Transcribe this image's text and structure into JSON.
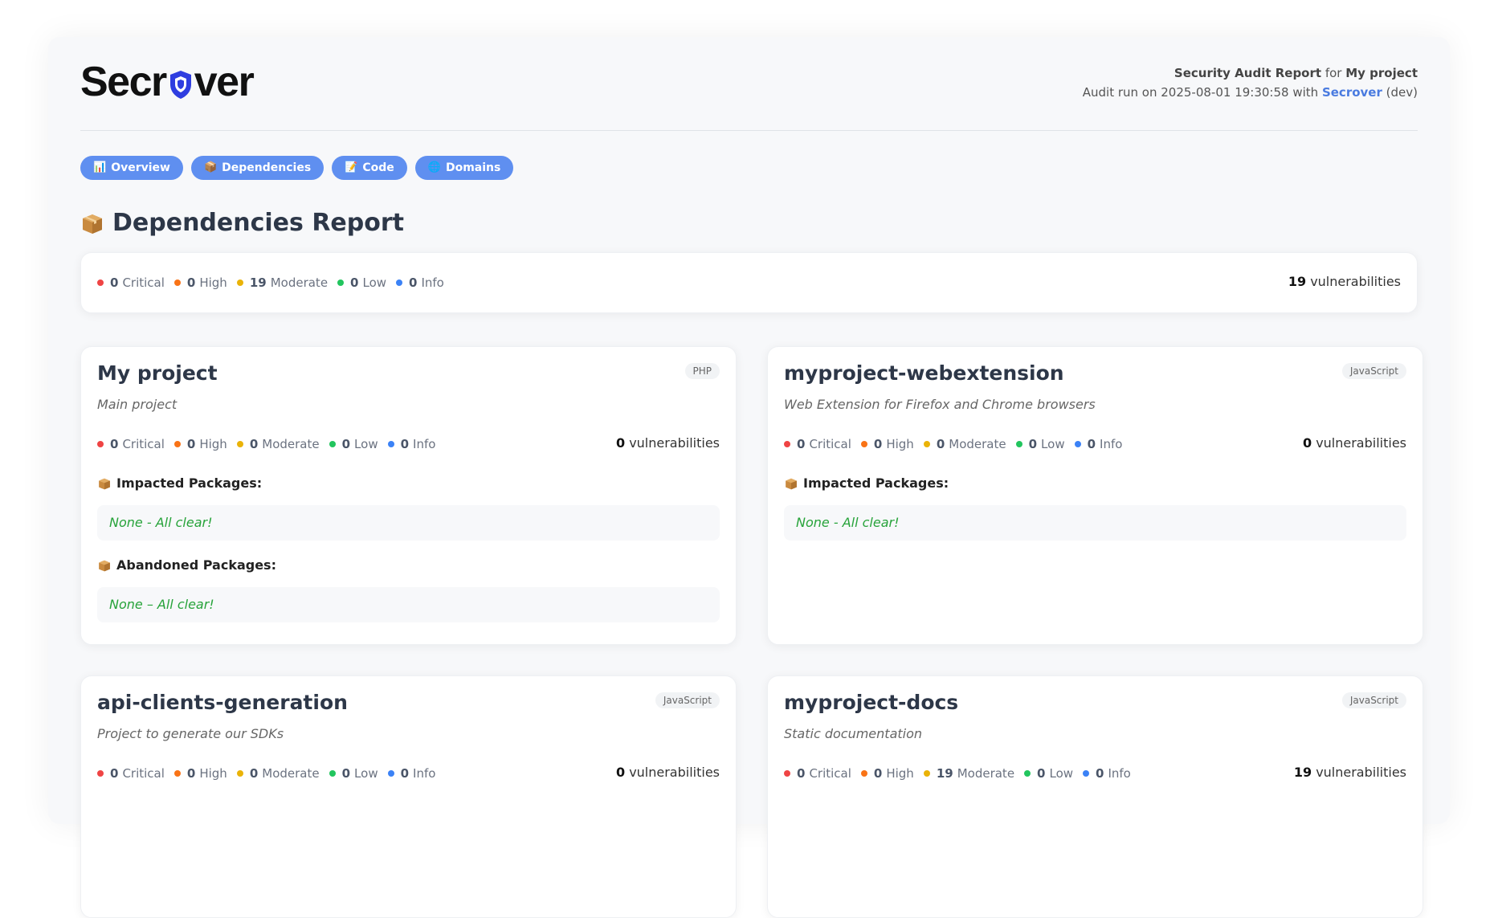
{
  "brand": {
    "logo_text_pre": "Secr",
    "logo_text_post": "ver"
  },
  "header": {
    "report_label": "Security Audit Report",
    "for_label": "for",
    "project_name": "My project",
    "audit_prefix": "Audit run on 2025-08-01 19:30:58 with",
    "tool_name": "Secrover",
    "tool_suffix": "(dev)"
  },
  "tabs": [
    {
      "icon": "📊",
      "label": "Overview"
    },
    {
      "icon": "📦",
      "label": "Dependencies"
    },
    {
      "icon": "📝",
      "label": "Code"
    },
    {
      "icon": "🌐",
      "label": "Domains"
    }
  ],
  "page_title": "Dependencies Report",
  "severity_labels": {
    "critical": "Critical",
    "high": "High",
    "moderate": "Moderate",
    "low": "Low",
    "info": "Info"
  },
  "colors": {
    "critical": "#ef4444",
    "high": "#f97316",
    "moderate": "#eab308",
    "low": "#22c55e",
    "info": "#3b82f6",
    "accent": "#5f8ff0",
    "clear": "#27a33a"
  },
  "summary": {
    "critical": "0",
    "high": "0",
    "moderate": "19",
    "low": "0",
    "info": "0",
    "total": "19",
    "total_label": "vulnerabilities"
  },
  "projects": [
    {
      "name": "My project",
      "language": "PHP",
      "description": "Main project",
      "critical": "0",
      "high": "0",
      "moderate": "0",
      "low": "0",
      "info": "0",
      "total": "0",
      "impacted_title": "Impacted Packages:",
      "impacted_status": "None - All clear!",
      "abandoned_title": "Abandoned Packages:",
      "abandoned_status": "None – All clear!"
    },
    {
      "name": "myproject-webextension",
      "language": "JavaScript",
      "description": "Web Extension for Firefox and Chrome browsers",
      "critical": "0",
      "high": "0",
      "moderate": "0",
      "low": "0",
      "info": "0",
      "total": "0",
      "impacted_title": "Impacted Packages:",
      "impacted_status": "None - All clear!"
    },
    {
      "name": "api-clients-generation",
      "language": "JavaScript",
      "description": "Project to generate our SDKs",
      "critical": "0",
      "high": "0",
      "moderate": "0",
      "low": "0",
      "info": "0",
      "total": "0"
    },
    {
      "name": "myproject-docs",
      "language": "JavaScript",
      "description": "Static documentation",
      "critical": "0",
      "high": "0",
      "moderate": "19",
      "low": "0",
      "info": "0",
      "total": "19"
    }
  ],
  "vuln_label": "vulnerabilities"
}
